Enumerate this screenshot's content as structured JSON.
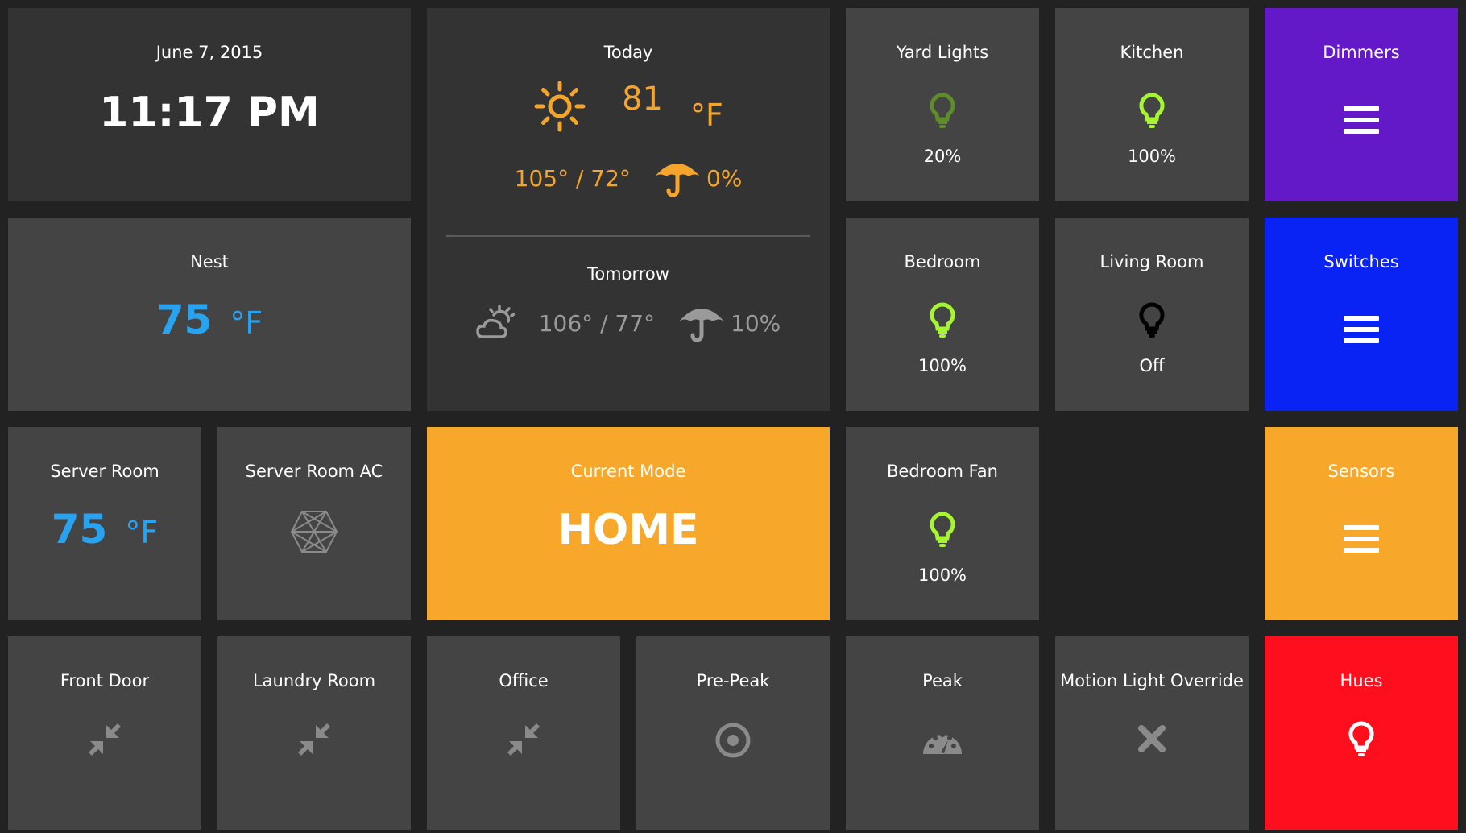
{
  "clock": {
    "date": "June 7, 2015",
    "time": "11:17 PM"
  },
  "nest": {
    "title": "Nest",
    "temp": "75",
    "unit": "°F"
  },
  "weather": {
    "today_label": "Today",
    "today_temp": "81",
    "today_unit": "°F",
    "today_hilo": "105° / 72°",
    "today_precip": "0%",
    "tomorrow_label": "Tomorrow",
    "tomorrow_hilo": "106° / 77°",
    "tomorrow_precip": "10%"
  },
  "lights": [
    {
      "name": "Yard Lights",
      "level": "20%",
      "state": "dim"
    },
    {
      "name": "Kitchen",
      "level": "100%",
      "state": "on"
    },
    {
      "name": "Bedroom",
      "level": "100%",
      "state": "on"
    },
    {
      "name": "Living Room",
      "level": "Off",
      "state": "off"
    },
    {
      "name": "Bedroom Fan",
      "level": "100%",
      "state": "on"
    }
  ],
  "server_room": {
    "title": "Server Room",
    "temp": "75",
    "unit": "°F"
  },
  "server_ac": {
    "title": "Server Room AC",
    "icon": "hexagon-icon"
  },
  "mode": {
    "title": "Current Mode",
    "value": "HOME"
  },
  "menus": {
    "dimmers": {
      "label": "Dimmers",
      "color": "#6419c8"
    },
    "switches": {
      "label": "Switches",
      "color": "#0a23f5"
    },
    "sensors": {
      "label": "Sensors",
      "color": "#f7a82b"
    },
    "hues": {
      "label": "Hues",
      "color": "#ff0f1e"
    }
  },
  "bottom": [
    {
      "name": "Front Door",
      "icon": "compress-arrows-icon"
    },
    {
      "name": "Laundry Room",
      "icon": "compress-arrows-icon"
    },
    {
      "name": "Office",
      "icon": "compress-arrows-icon"
    },
    {
      "name": "Pre-Peak",
      "icon": "target-icon"
    },
    {
      "name": "Peak",
      "icon": "dashboard-icon"
    },
    {
      "name": "Motion Light Override",
      "icon": "close-icon"
    }
  ],
  "colors": {
    "background": "#222222",
    "tile_dark": "#333333",
    "tile_mid": "#444444",
    "temp_blue": "#29a3f0",
    "weather_orange": "#f5a52c",
    "bulb_on": "#a6f533",
    "bulb_dim": "#5e8c28",
    "bulb_off": "#000000",
    "mode_orange": "#f7a82b"
  }
}
